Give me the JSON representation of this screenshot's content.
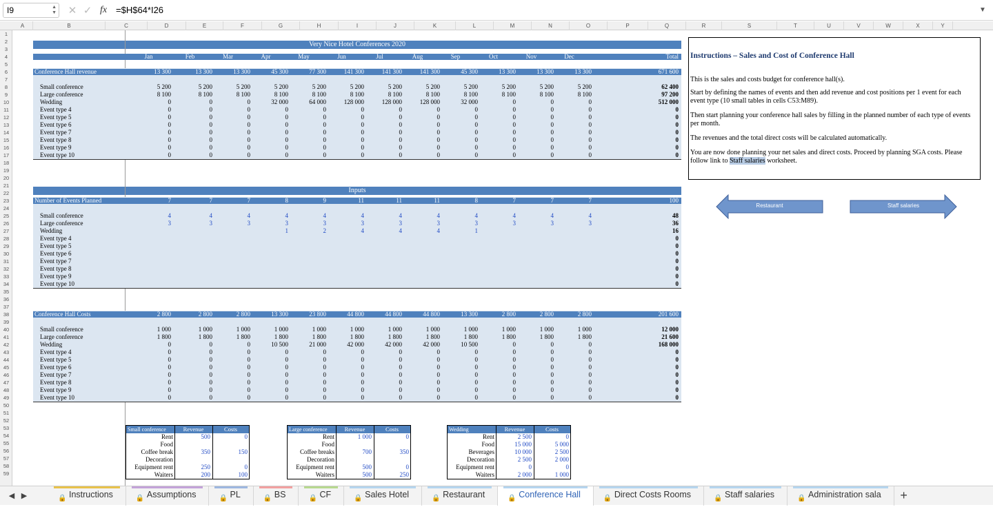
{
  "formula_bar": {
    "cell_ref": "I9",
    "formula": "=$H$64*I26"
  },
  "columns": [
    "A",
    "B",
    "C",
    "D",
    "E",
    "F",
    "G",
    "H",
    "I",
    "J",
    "K",
    "L",
    "M",
    "N",
    "O",
    "P",
    "Q",
    "R",
    "S",
    "T",
    "U",
    "V",
    "W",
    "X",
    "Y"
  ],
  "rows": [
    "1",
    "2",
    "3",
    "4",
    "5",
    "6",
    "7",
    "8",
    "9",
    "10",
    "11",
    "12",
    "13",
    "14",
    "15",
    "16",
    "17",
    "18",
    "19",
    "20",
    "21",
    "22",
    "23",
    "24",
    "25",
    "26",
    "27",
    "28",
    "29",
    "30",
    "31",
    "32",
    "33",
    "34",
    "35",
    "36",
    "37",
    "38",
    "39",
    "40",
    "41",
    "42",
    "43",
    "44",
    "45",
    "46",
    "47",
    "48",
    "49",
    "50",
    "51",
    "52",
    "53",
    "54",
    "55",
    "56",
    "57",
    "58",
    "59"
  ],
  "title": "Very Nice Hotel Conferences 2020",
  "months": [
    "Jan",
    "Feb",
    "Mar",
    "Apr",
    "May",
    "Jun",
    "Jul",
    "Aug",
    "Sep",
    "Oct",
    "Nov",
    "Dec"
  ],
  "total_label": "Total",
  "revenue": {
    "label": "Conference Hall revenue",
    "totals": [
      "13 300",
      "13 300",
      "13 300",
      "45 300",
      "77 300",
      "141 300",
      "141 300",
      "141 300",
      "45 300",
      "13 300",
      "13 300",
      "13 300"
    ],
    "grand_total": "671 600",
    "rows": [
      {
        "label": "Small conference",
        "values": [
          "5 200",
          "5 200",
          "5 200",
          "5 200",
          "5 200",
          "5 200",
          "5 200",
          "5 200",
          "5 200",
          "5 200",
          "5 200",
          "5 200"
        ],
        "total": "62 400"
      },
      {
        "label": "Large conference",
        "values": [
          "8 100",
          "8 100",
          "8 100",
          "8 100",
          "8 100",
          "8 100",
          "8 100",
          "8 100",
          "8 100",
          "8 100",
          "8 100",
          "8 100"
        ],
        "total": "97 200"
      },
      {
        "label": "Wedding",
        "values": [
          "0",
          "0",
          "0",
          "32 000",
          "64 000",
          "128 000",
          "128 000",
          "128 000",
          "32 000",
          "0",
          "0",
          "0"
        ],
        "total": "512 000"
      },
      {
        "label": "Event type 4",
        "values": [
          "0",
          "0",
          "0",
          "0",
          "0",
          "0",
          "0",
          "0",
          "0",
          "0",
          "0",
          "0"
        ],
        "total": "0"
      },
      {
        "label": "Event type 5",
        "values": [
          "0",
          "0",
          "0",
          "0",
          "0",
          "0",
          "0",
          "0",
          "0",
          "0",
          "0",
          "0"
        ],
        "total": "0"
      },
      {
        "label": "Event type 6",
        "values": [
          "0",
          "0",
          "0",
          "0",
          "0",
          "0",
          "0",
          "0",
          "0",
          "0",
          "0",
          "0"
        ],
        "total": "0"
      },
      {
        "label": "Event type 7",
        "values": [
          "0",
          "0",
          "0",
          "0",
          "0",
          "0",
          "0",
          "0",
          "0",
          "0",
          "0",
          "0"
        ],
        "total": "0"
      },
      {
        "label": "Event type 8",
        "values": [
          "0",
          "0",
          "0",
          "0",
          "0",
          "0",
          "0",
          "0",
          "0",
          "0",
          "0",
          "0"
        ],
        "total": "0"
      },
      {
        "label": "Event type 9",
        "values": [
          "0",
          "0",
          "0",
          "0",
          "0",
          "0",
          "0",
          "0",
          "0",
          "0",
          "0",
          "0"
        ],
        "total": "0"
      },
      {
        "label": "Event type 10",
        "values": [
          "0",
          "0",
          "0",
          "0",
          "0",
          "0",
          "0",
          "0",
          "0",
          "0",
          "0",
          "0"
        ],
        "total": "0"
      }
    ]
  },
  "inputs_title": "Inputs",
  "events": {
    "label": "Number of Events Planned",
    "totals": [
      "7",
      "7",
      "7",
      "8",
      "9",
      "11",
      "11",
      "11",
      "8",
      "7",
      "7",
      "7"
    ],
    "grand_total": "100",
    "rows": [
      {
        "label": "Small conference",
        "values": [
          "4",
          "4",
          "4",
          "4",
          "4",
          "4",
          "4",
          "4",
          "4",
          "4",
          "4",
          "4"
        ],
        "total": "48"
      },
      {
        "label": "Large conference",
        "values": [
          "3",
          "3",
          "3",
          "3",
          "3",
          "3",
          "3",
          "3",
          "3",
          "3",
          "3",
          "3"
        ],
        "total": "36"
      },
      {
        "label": "Wedding",
        "values": [
          "",
          "",
          "",
          "1",
          "2",
          "4",
          "4",
          "4",
          "1",
          "",
          "",
          ""
        ],
        "total": "16"
      },
      {
        "label": "Event type 4",
        "values": [
          "",
          "",
          "",
          "",
          "",
          "",
          "",
          "",
          "",
          "",
          "",
          ""
        ],
        "total": "0"
      },
      {
        "label": "Event type 5",
        "values": [
          "",
          "",
          "",
          "",
          "",
          "",
          "",
          "",
          "",
          "",
          "",
          ""
        ],
        "total": "0"
      },
      {
        "label": "Event type 6",
        "values": [
          "",
          "",
          "",
          "",
          "",
          "",
          "",
          "",
          "",
          "",
          "",
          ""
        ],
        "total": "0"
      },
      {
        "label": "Event type 7",
        "values": [
          "",
          "",
          "",
          "",
          "",
          "",
          "",
          "",
          "",
          "",
          "",
          ""
        ],
        "total": "0"
      },
      {
        "label": "Event type 8",
        "values": [
          "",
          "",
          "",
          "",
          "",
          "",
          "",
          "",
          "",
          "",
          "",
          ""
        ],
        "total": "0"
      },
      {
        "label": "Event type 9",
        "values": [
          "",
          "",
          "",
          "",
          "",
          "",
          "",
          "",
          "",
          "",
          "",
          ""
        ],
        "total": "0"
      },
      {
        "label": "Event type 10",
        "values": [
          "",
          "",
          "",
          "",
          "",
          "",
          "",
          "",
          "",
          "",
          "",
          ""
        ],
        "total": "0"
      }
    ]
  },
  "costs": {
    "label": "Conference Hall Costs",
    "totals": [
      "2 800",
      "2 800",
      "2 800",
      "13 300",
      "23 800",
      "44 800",
      "44 800",
      "44 800",
      "13 300",
      "2 800",
      "2 800",
      "2 800"
    ],
    "grand_total": "201 600",
    "rows": [
      {
        "label": "Small conference",
        "values": [
          "1 000",
          "1 000",
          "1 000",
          "1 000",
          "1 000",
          "1 000",
          "1 000",
          "1 000",
          "1 000",
          "1 000",
          "1 000",
          "1 000"
        ],
        "total": "12 000"
      },
      {
        "label": "Large conference",
        "values": [
          "1 800",
          "1 800",
          "1 800",
          "1 800",
          "1 800",
          "1 800",
          "1 800",
          "1 800",
          "1 800",
          "1 800",
          "1 800",
          "1 800"
        ],
        "total": "21 600"
      },
      {
        "label": "Wedding",
        "values": [
          "0",
          "0",
          "0",
          "10 500",
          "21 000",
          "42 000",
          "42 000",
          "42 000",
          "10 500",
          "0",
          "0",
          "0"
        ],
        "total": "168 000"
      },
      {
        "label": "Event type 4",
        "values": [
          "0",
          "0",
          "0",
          "0",
          "0",
          "0",
          "0",
          "0",
          "0",
          "0",
          "0",
          "0"
        ],
        "total": "0"
      },
      {
        "label": "Event type 5",
        "values": [
          "0",
          "0",
          "0",
          "0",
          "0",
          "0",
          "0",
          "0",
          "0",
          "0",
          "0",
          "0"
        ],
        "total": "0"
      },
      {
        "label": "Event type 6",
        "values": [
          "0",
          "0",
          "0",
          "0",
          "0",
          "0",
          "0",
          "0",
          "0",
          "0",
          "0",
          "0"
        ],
        "total": "0"
      },
      {
        "label": "Event type 7",
        "values": [
          "0",
          "0",
          "0",
          "0",
          "0",
          "0",
          "0",
          "0",
          "0",
          "0",
          "0",
          "0"
        ],
        "total": "0"
      },
      {
        "label": "Event type 8",
        "values": [
          "0",
          "0",
          "0",
          "0",
          "0",
          "0",
          "0",
          "0",
          "0",
          "0",
          "0",
          "0"
        ],
        "total": "0"
      },
      {
        "label": "Event type 9",
        "values": [
          "0",
          "0",
          "0",
          "0",
          "0",
          "0",
          "0",
          "0",
          "0",
          "0",
          "0",
          "0"
        ],
        "total": "0"
      },
      {
        "label": "Event type 10",
        "values": [
          "0",
          "0",
          "0",
          "0",
          "0",
          "0",
          "0",
          "0",
          "0",
          "0",
          "0",
          "0"
        ],
        "total": "0"
      }
    ]
  },
  "mini_tables": [
    {
      "name": "Small conference",
      "rev_label": "Revenue",
      "cost_label": "Costs",
      "rows": [
        {
          "label": "Rent",
          "rev": "500",
          "cost": "0"
        },
        {
          "label": "Food",
          "rev": "",
          "cost": ""
        },
        {
          "label": "Coffee break",
          "rev": "350",
          "cost": "150"
        },
        {
          "label": "Decoration",
          "rev": "",
          "cost": ""
        },
        {
          "label": "Equipment rent",
          "rev": "250",
          "cost": "0"
        },
        {
          "label": "Waiters",
          "rev": "200",
          "cost": "100"
        }
      ]
    },
    {
      "name": "Large conference",
      "rev_label": "Revenue",
      "cost_label": "Costs",
      "rows": [
        {
          "label": "Rent",
          "rev": "1 000",
          "cost": "0"
        },
        {
          "label": "Food",
          "rev": "",
          "cost": ""
        },
        {
          "label": "Coffee breaks",
          "rev": "700",
          "cost": "350"
        },
        {
          "label": "Decoration",
          "rev": "",
          "cost": ""
        },
        {
          "label": "Equipment rent",
          "rev": "500",
          "cost": "0"
        },
        {
          "label": "Waiters",
          "rev": "500",
          "cost": "250"
        }
      ]
    },
    {
      "name": "Wedding",
      "rev_label": "Revenue",
      "cost_label": "Costs",
      "rows": [
        {
          "label": "Rent",
          "rev": "2 500",
          "cost": "0"
        },
        {
          "label": "Food",
          "rev": "15 000",
          "cost": "5 000"
        },
        {
          "label": "Beverages",
          "rev": "10 000",
          "cost": "2 500"
        },
        {
          "label": "Decoration",
          "rev": "2 500",
          "cost": "2 000"
        },
        {
          "label": "Equipment rent",
          "rev": "0",
          "cost": "0"
        },
        {
          "label": "Waiters",
          "rev": "2 000",
          "cost": "1 000"
        }
      ]
    }
  ],
  "instructions": {
    "title": "Instructions – Sales and Cost of Conference Hall",
    "p1": "This is the sales and costs budget for conference hall(s).",
    "p2": "Start by defining the names of events and then add revenue and cost positions per 1 event for each event type (10 small tables in cells C53:M89).",
    "p3": "Then start planning your conference hall sales by filling in the planned number of each type of events per month.",
    "p4": "The revenues and the total direct costs will be calculated automatically.",
    "p5a": "You are now done planning your net sales and direct costs. Proceed by planning SGA costs. Please follow link to ",
    "p5link": "Staff salaries",
    "p5b": " worksheet."
  },
  "nav_buttons": {
    "back": "Restaurant",
    "next": "Staff salaries"
  },
  "tabs": [
    {
      "label": "Instructions",
      "color": "#e8c24a",
      "active": false
    },
    {
      "label": "Assumptions",
      "color": "#c3a3d9",
      "active": false
    },
    {
      "label": "PL",
      "color": "#9db7e0",
      "active": false
    },
    {
      "label": "BS",
      "color": "#f2a0a0",
      "active": false
    },
    {
      "label": "CF",
      "color": "#b7d98f",
      "active": false
    },
    {
      "label": "Sales Hotel",
      "color": "#b5d5ef",
      "active": false
    },
    {
      "label": "Restaurant",
      "color": "#b5d5ef",
      "active": false
    },
    {
      "label": "Conference Hall",
      "color": "#b5d5ef",
      "active": true
    },
    {
      "label": "Direct Costs Rooms",
      "color": "#b5d5ef",
      "active": false
    },
    {
      "label": "Staff salaries",
      "color": "#b5d5ef",
      "active": false
    },
    {
      "label": "Administration sala",
      "color": "#b5d5ef",
      "active": false
    }
  ]
}
